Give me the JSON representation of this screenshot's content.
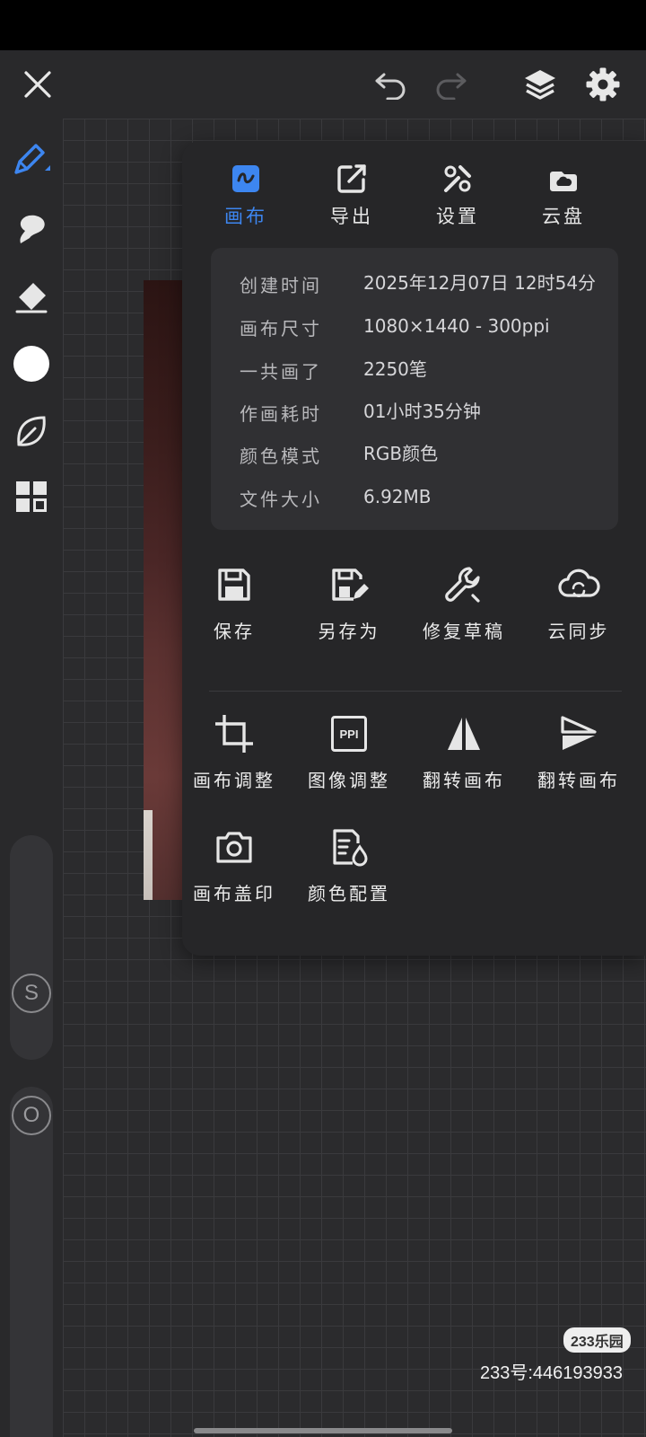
{
  "toolbar": {
    "icons": [
      "close-icon",
      "undo-icon",
      "redo-icon",
      "layers-icon",
      "gear-icon"
    ]
  },
  "left_tools": [
    "pencil-icon",
    "smudge-icon",
    "eraser-icon",
    "color-swatch",
    "leaf-icon",
    "grid-icon"
  ],
  "sliders": {
    "size_label": "S",
    "opacity_label": "O"
  },
  "panel": {
    "tabs": [
      {
        "label": "画布",
        "icon": "canvas-icon",
        "active": true
      },
      {
        "label": "导出",
        "icon": "export-icon",
        "active": false
      },
      {
        "label": "设置",
        "icon": "settings-icon",
        "active": false
      },
      {
        "label": "云盘",
        "icon": "cloud-drive-icon",
        "active": false
      }
    ],
    "info": [
      {
        "key": "创建时间",
        "value": "2025年12月07日 12时54分"
      },
      {
        "key": "画布尺寸",
        "value": "1080×1440 - 300ppi"
      },
      {
        "key": "一共画了",
        "value": "2250笔"
      },
      {
        "key": "作画耗时",
        "value": "01小时35分钟"
      },
      {
        "key": "颜色模式",
        "value": "RGB颜色"
      },
      {
        "key": "文件大小",
        "value": "6.92MB"
      }
    ],
    "actions_primary": [
      {
        "label": "保存",
        "icon": "save-icon"
      },
      {
        "label": "另存为",
        "icon": "save-as-icon"
      },
      {
        "label": "修复草稿",
        "icon": "wrench-icon"
      },
      {
        "label": "云同步",
        "icon": "cloud-sync-icon"
      }
    ],
    "actions_secondary": [
      {
        "label": "画布调整",
        "icon": "crop-icon"
      },
      {
        "label": "图像调整",
        "icon": "ppi-icon",
        "icon_text": "PPI"
      },
      {
        "label": "翻转画布",
        "icon": "flip-horizontal-icon"
      },
      {
        "label": "翻转画布",
        "icon": "flip-vertical-icon"
      },
      {
        "label": "画布盖印",
        "icon": "camera-icon"
      },
      {
        "label": "颜色配置",
        "icon": "color-profile-icon"
      }
    ]
  },
  "colors": {
    "accent": "#3d86f0",
    "panel_bg": "#262628",
    "card_bg": "#303033"
  },
  "watermark": {
    "logo": "233乐园",
    "text": "233号:446193933"
  }
}
